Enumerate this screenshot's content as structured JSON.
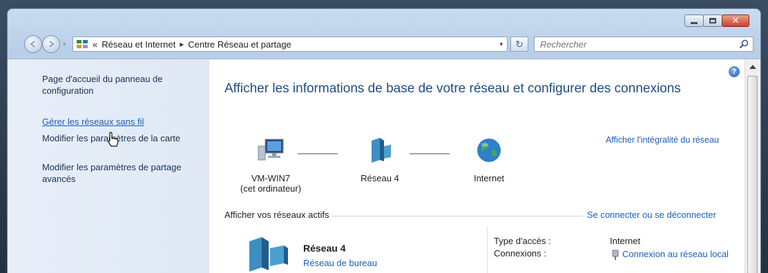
{
  "window": {
    "buttons": {
      "close_glyph": "✕"
    }
  },
  "address_bar": {
    "prefix": "«",
    "crumbs": [
      "Réseau et Internet",
      "Centre Réseau et partage"
    ],
    "separator": "▸",
    "dropdown_glyph": "▾"
  },
  "refresh_glyph": "↻",
  "search": {
    "placeholder": "Rechercher"
  },
  "left_pane": {
    "items": [
      "Page d'accueil du panneau de configuration",
      "Gérer les réseaux sans fil",
      "Modifier les paramètres de la carte",
      "Modifier les paramètres de partage avancés"
    ]
  },
  "main": {
    "heading": "Afficher les informations de base de votre réseau et configurer des connexions",
    "full_map_link": "Afficher l'intégralité du réseau",
    "nodes": [
      {
        "label": "VM-WIN7",
        "sublabel": "(cet ordinateur)",
        "icon": "computer-icon"
      },
      {
        "label": "Réseau 4",
        "sublabel": "",
        "icon": "network-icon"
      },
      {
        "label": "Internet",
        "sublabel": "",
        "icon": "globe-icon"
      }
    ],
    "active_networks_title": "Afficher vos réseaux actifs",
    "connect_link": "Se connecter ou se déconnecter",
    "network": {
      "name": "Réseau 4",
      "type": "Réseau de bureau",
      "access_label": "Type d'accès :",
      "access_value": "Internet",
      "connections_label": "Connexions :",
      "connections_value": "Connexion au réseau local"
    }
  },
  "help_glyph": "?",
  "colors": {
    "link": "#1b5fb8",
    "heading": "#1e4e84",
    "close": "#c9452d"
  }
}
